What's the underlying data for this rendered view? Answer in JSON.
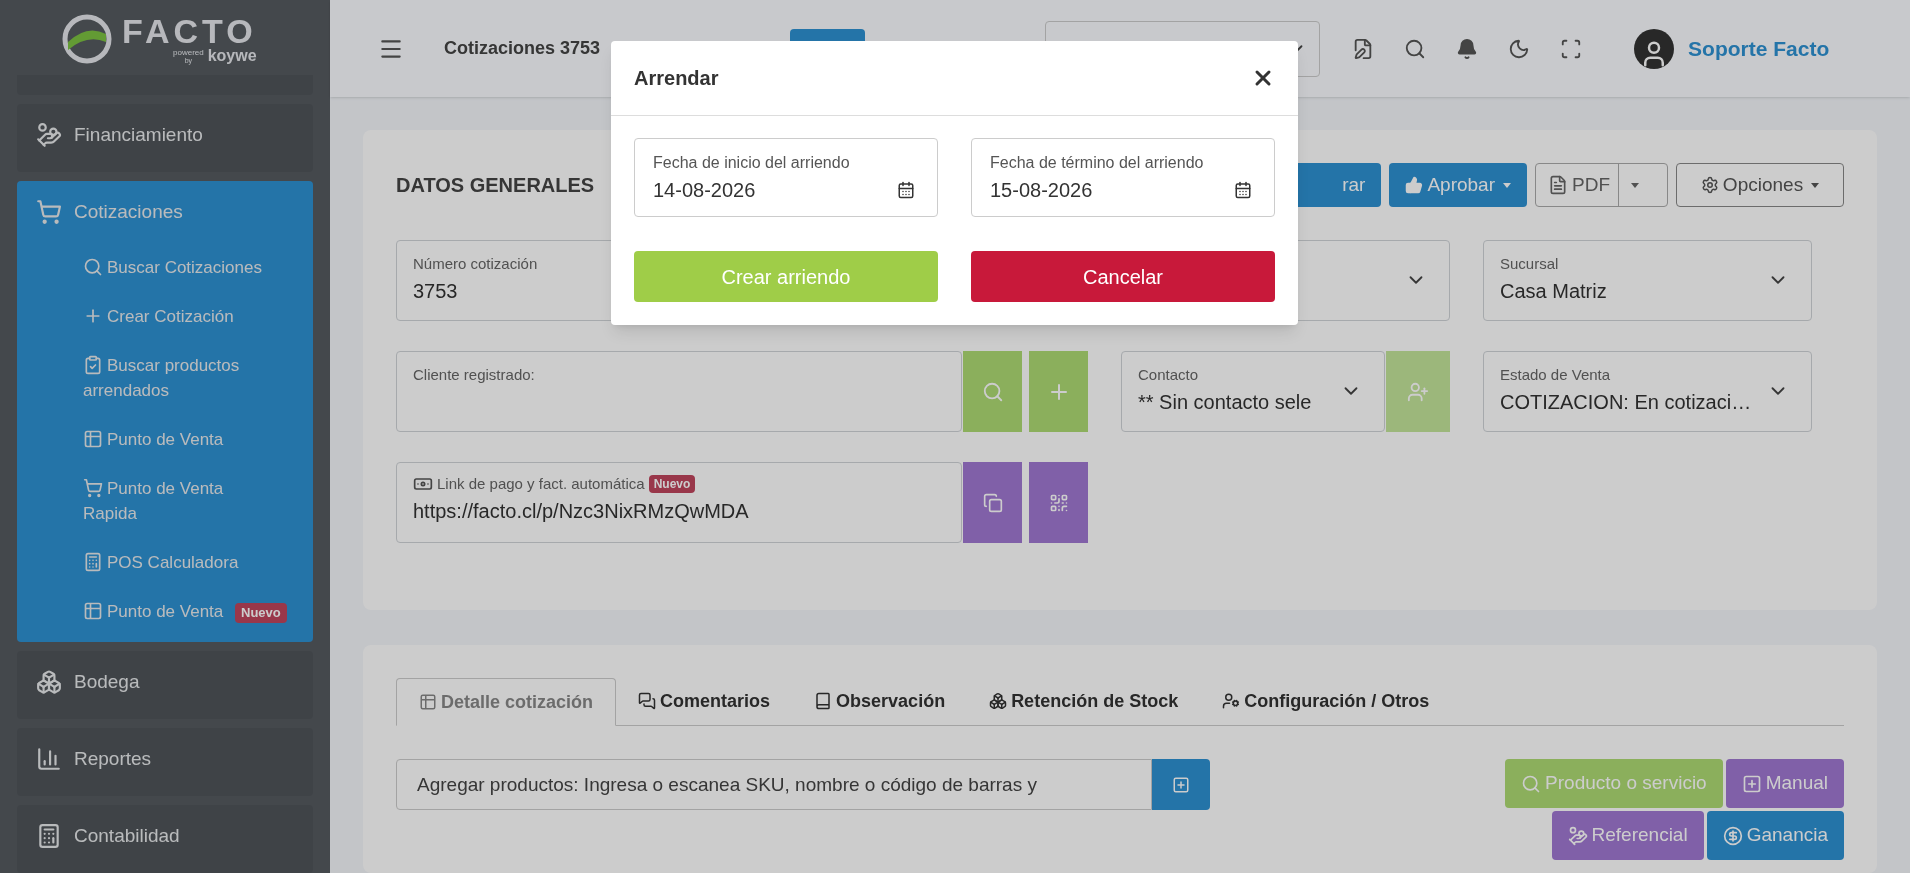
{
  "logo": {
    "name": "FACTO",
    "powered": "powered",
    "by": "by",
    "brand": "koywe"
  },
  "sidebar": {
    "items": [
      {
        "label": "Financiamiento",
        "selected": false
      },
      {
        "label": "Cotizaciones",
        "selected": true,
        "children": [
          {
            "label": "Buscar Cotizaciones"
          },
          {
            "label": "Crear Cotización"
          },
          {
            "label": "Buscar productos arrendados"
          },
          {
            "label": "Punto de Venta"
          },
          {
            "label": "Punto de Venta Rapida"
          },
          {
            "label": "POS Calculadora"
          },
          {
            "label": "Punto de Venta",
            "badge": "Nuevo"
          }
        ]
      },
      {
        "label": "Bodega",
        "selected": false
      },
      {
        "label": "Reportes",
        "selected": false
      },
      {
        "label": "Contabilidad",
        "selected": false
      }
    ]
  },
  "header": {
    "title": "Cotizaciones 3753",
    "user": "Soporte Facto"
  },
  "general": {
    "title": "DATOS GENERALES",
    "actions": [
      {
        "label": "rar",
        "kind": "solid"
      },
      {
        "label": "Aprobar",
        "kind": "dropdown"
      },
      {
        "label": "PDF",
        "kind": "split"
      },
      {
        "label": "Opciones",
        "kind": "outline"
      }
    ],
    "numero": {
      "label": "Número cotización",
      "value": "3753"
    },
    "sucursal": {
      "label": "Sucursal",
      "value": "Casa Matriz"
    },
    "cliente": {
      "label": "Cliente registrado:"
    },
    "contacto": {
      "label": "Contacto",
      "value": "** Sin contacto sele"
    },
    "estado": {
      "label": "Estado de Venta",
      "value": "COTIZACION: En cotizaci…"
    },
    "link": {
      "label": "Link de pago y fact. automática",
      "badge": "Nuevo",
      "value": "https://facto.cl/p/Nzc3NixRMzQwMDA"
    }
  },
  "detail": {
    "tabs": [
      {
        "label": "Detalle cotización",
        "selected": true
      },
      {
        "label": "Comentarios",
        "selected": false
      },
      {
        "label": "Observación",
        "selected": false
      },
      {
        "label": "Retención de Stock",
        "selected": false
      },
      {
        "label": "Configuración / Otros",
        "selected": false
      }
    ],
    "search": {
      "placeholder": "Agregar productos: Ingresa o escanea SKU, nombre o código de barras y"
    },
    "buttons": [
      {
        "label": "Producto o servicio",
        "kind": "green"
      },
      {
        "label": "Manual",
        "kind": "purple"
      },
      {
        "label": "Referencial",
        "kind": "purple"
      },
      {
        "label": "Ganancia",
        "kind": "blue"
      }
    ]
  },
  "modal": {
    "title": "Arrendar",
    "fields": [
      {
        "label": "Fecha de inicio del arriendo",
        "value": "14-08-2026"
      },
      {
        "label": "Fecha de término del arriendo",
        "value": "15-08-2026"
      }
    ],
    "buttons": [
      {
        "label": "Crear arriendo",
        "kind": "confirm"
      },
      {
        "label": "Cancelar",
        "kind": "cancel"
      }
    ]
  }
}
